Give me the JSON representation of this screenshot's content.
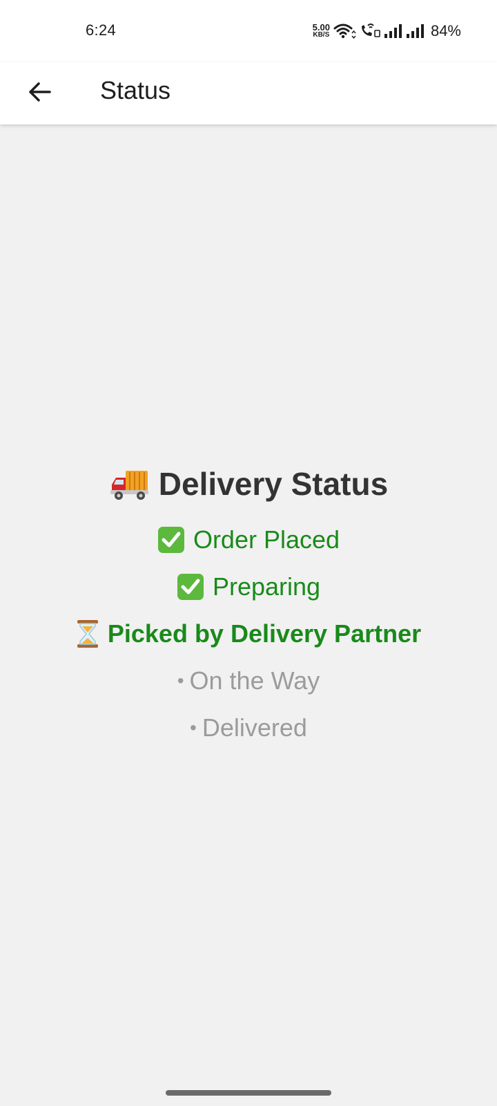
{
  "status_bar": {
    "time": "6:24",
    "speed_value": "5.00",
    "speed_unit": "KB/S",
    "battery": "84%"
  },
  "app_bar": {
    "title": "Status",
    "back_icon": "arrow-left-icon"
  },
  "delivery": {
    "heading": "Delivery Status",
    "heading_icon": "delivery-truck-icon",
    "steps": [
      {
        "label": "Order Placed",
        "state": "done",
        "icon": "check-mark-icon"
      },
      {
        "label": "Preparing",
        "state": "done",
        "icon": "check-mark-icon"
      },
      {
        "label": "Picked by Delivery Partner",
        "state": "current",
        "icon": "hourglass-icon"
      },
      {
        "label": "On the Way",
        "state": "pending",
        "icon": "bullet-icon"
      },
      {
        "label": "Delivered",
        "state": "pending",
        "icon": "bullet-icon"
      }
    ]
  },
  "colors": {
    "done": "#198a1a",
    "pending": "#9b9b9b",
    "heading": "#333333",
    "background": "#f1f1f1"
  }
}
